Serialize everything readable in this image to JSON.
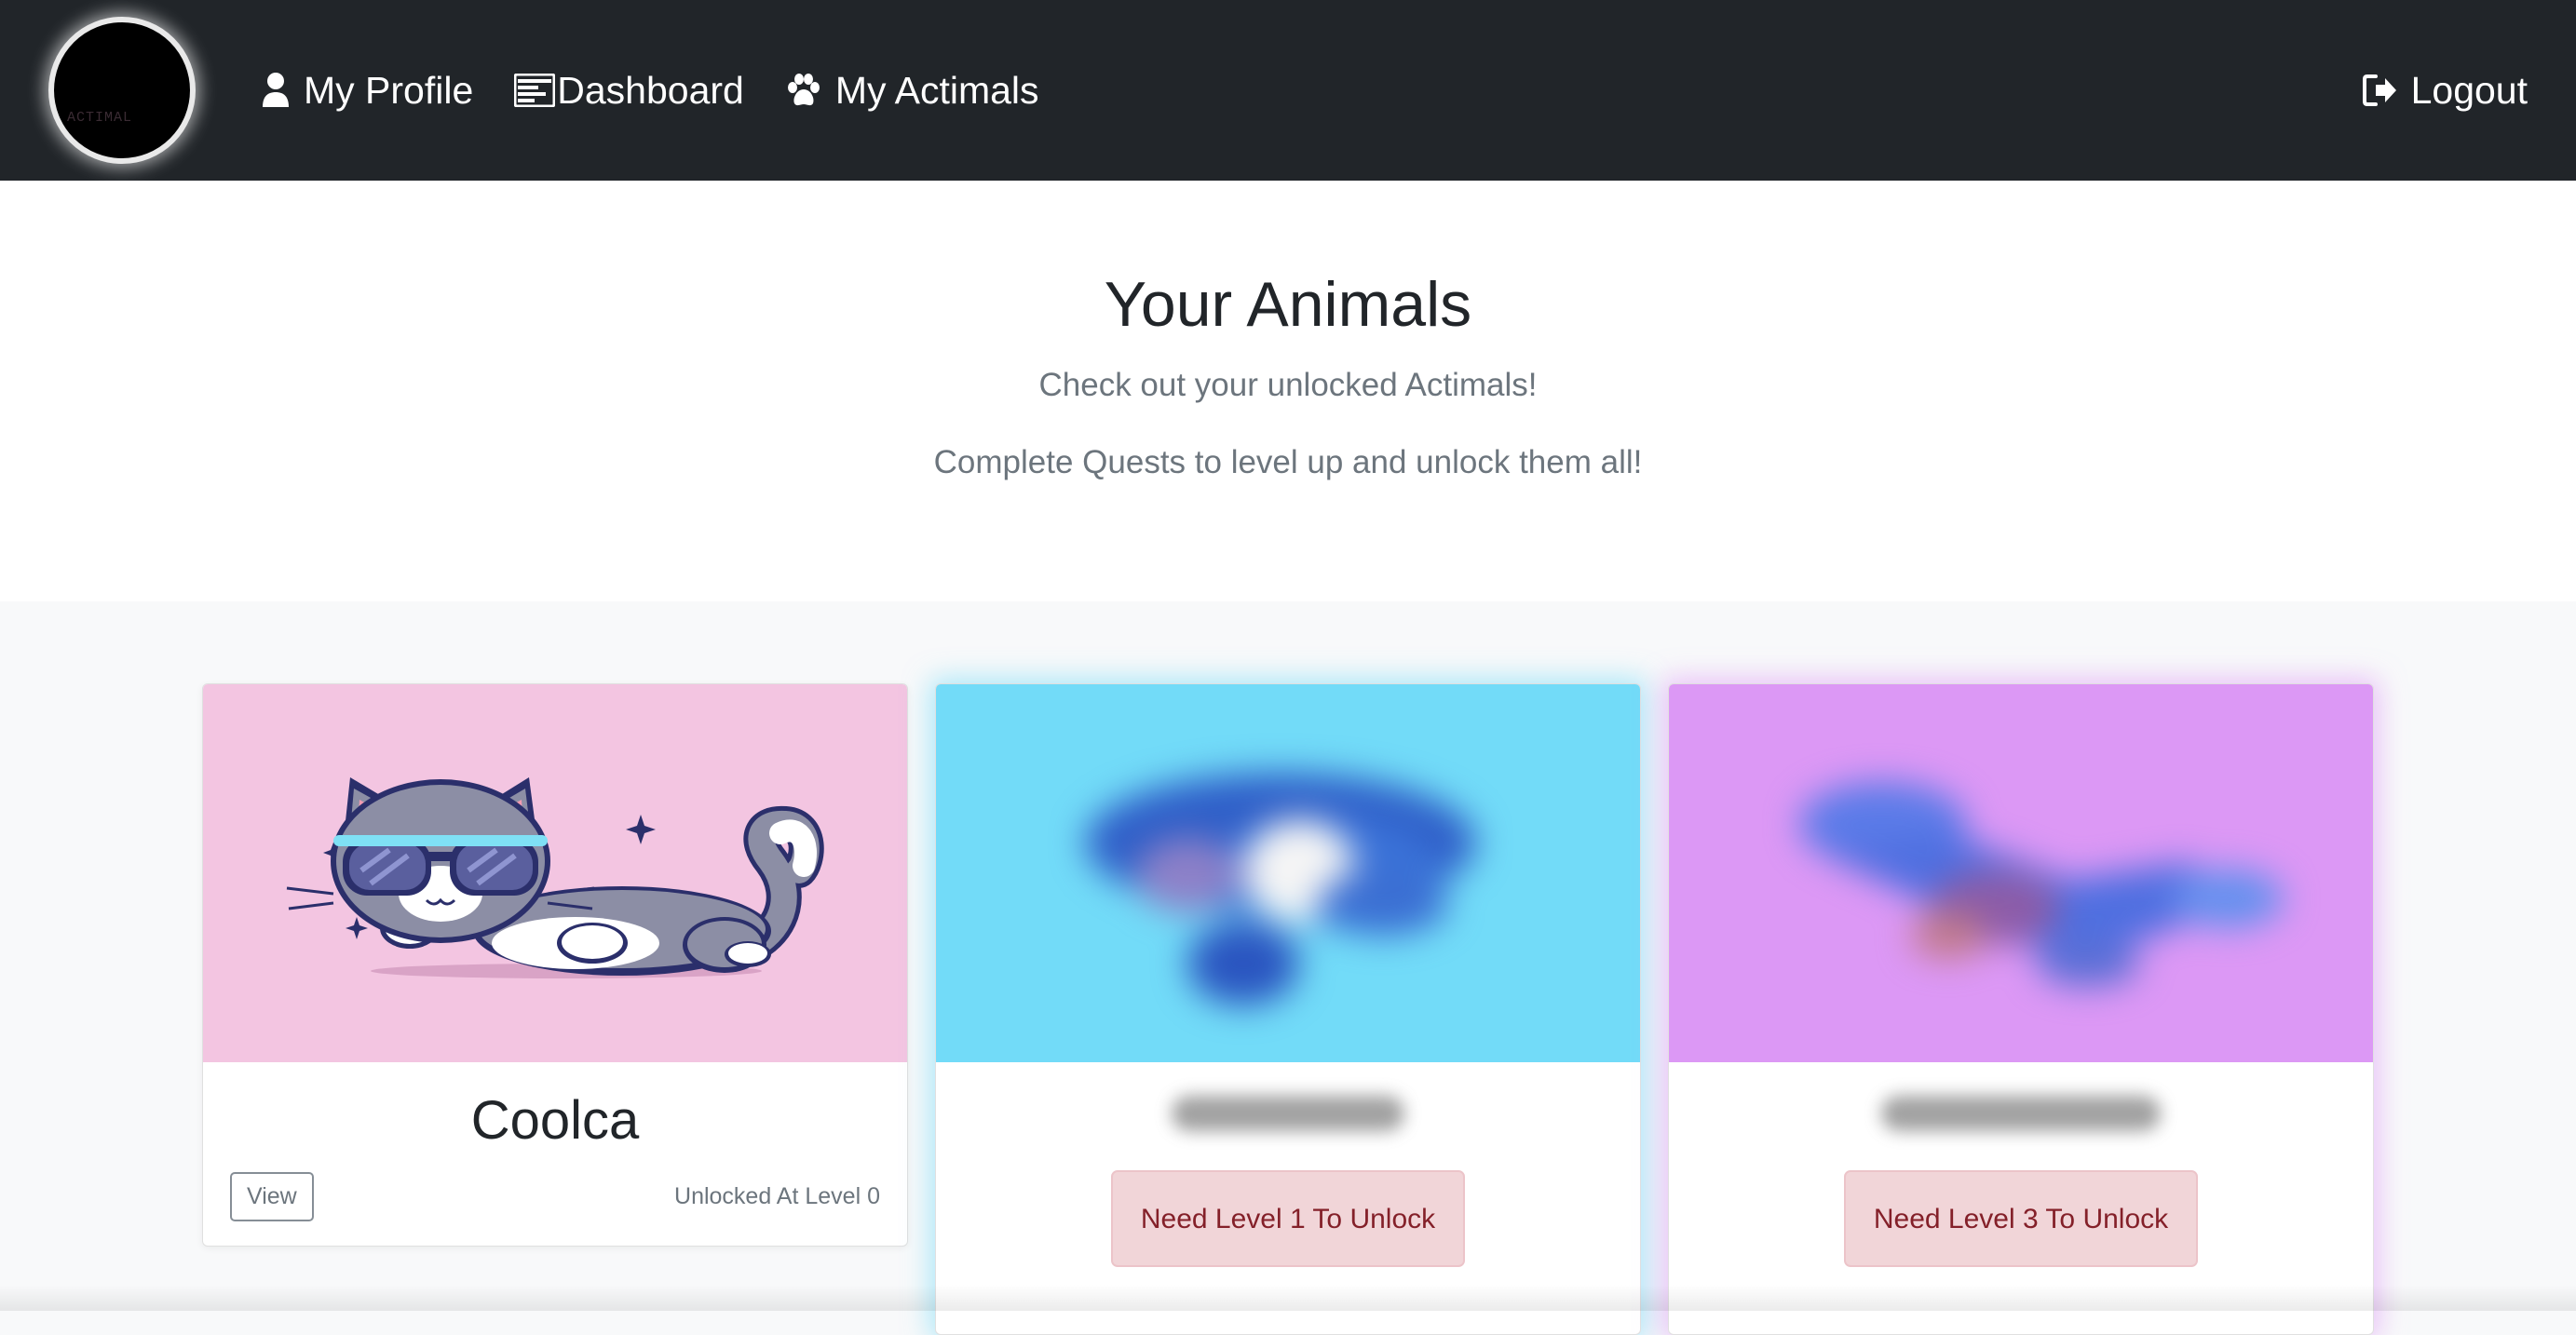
{
  "brand": {
    "logo_text": "ACTIMAL"
  },
  "nav": {
    "profile_label": "My Profile",
    "dashboard_label": "Dashboard",
    "actimals_label": "My Actimals",
    "logout_label": "Logout",
    "profile_icon": "user-icon",
    "dashboard_icon": "dashboard-icon",
    "actimals_icon": "paw-icon",
    "logout_icon": "logout-icon"
  },
  "hero": {
    "title": "Your Animals",
    "subtitle": "Check out your unlocked Actimals!",
    "tagline": "Complete Quests to level up and unlock them all!"
  },
  "animals": [
    {
      "name": "Coolca",
      "status": "unlocked",
      "view_label": "View",
      "unlock_text": "Unlocked At Level 0",
      "bg_color": "#f3c5e1"
    },
    {
      "status": "locked",
      "locked_text": "Need Level 1 To Unlock",
      "bg_color": "#72dbf8"
    },
    {
      "status": "locked",
      "locked_text": "Need Level 3 To Unlock",
      "bg_color": "#dc98f5"
    }
  ],
  "colors": {
    "navbar": "#212529",
    "locked_bg": "#f1d5d8",
    "locked_text": "#842029"
  }
}
